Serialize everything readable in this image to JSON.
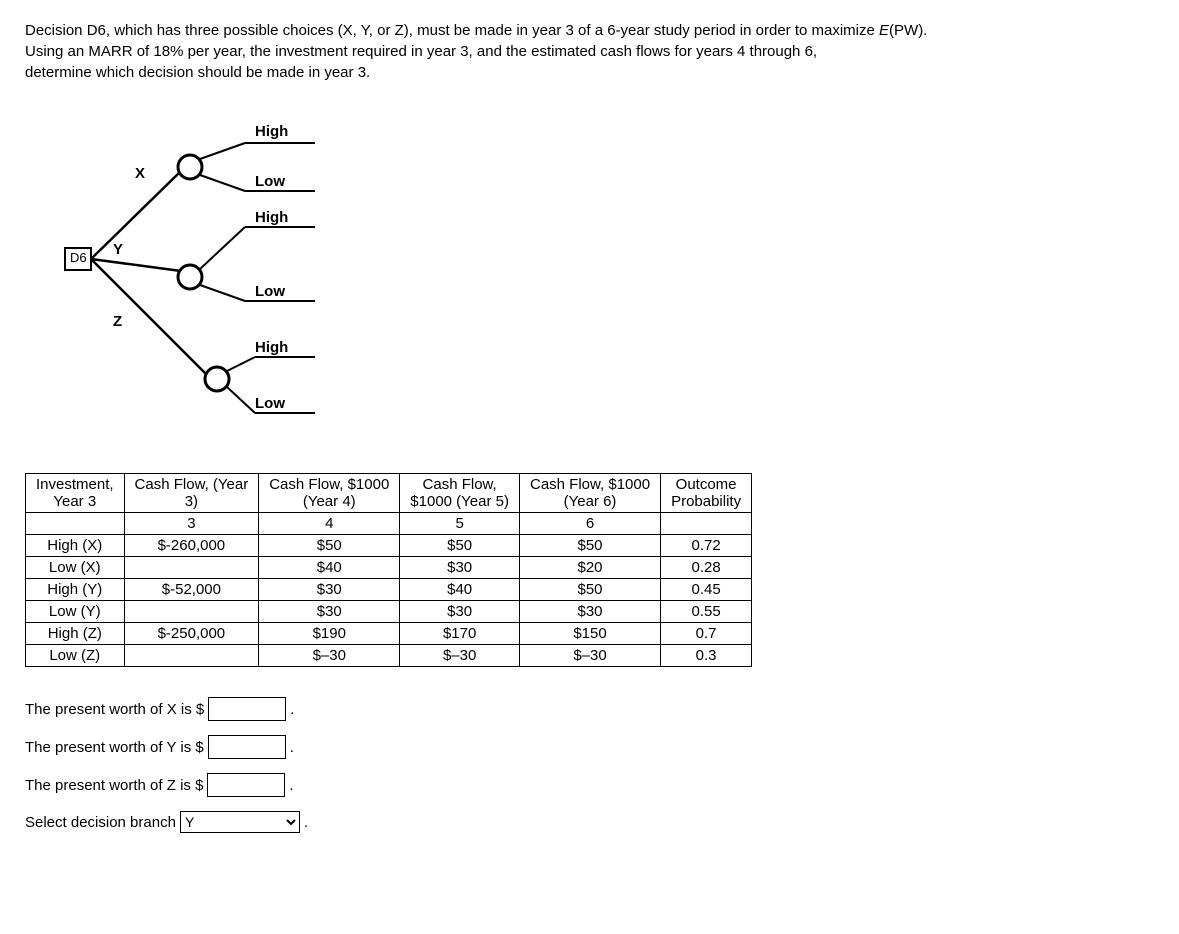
{
  "question": {
    "line1a": "Decision D6, which has three possible choices (X, Y, or Z), must be made in year 3 of a 6-year study period in order to maximize ",
    "line1b": "E",
    "line1c": "(PW).",
    "line2": "Using an MARR of 18% per year, the investment required in year 3, and the estimated cash flows for years 4 through 6,",
    "line3": "determine which decision should be made in year 3."
  },
  "diagram": {
    "d6": "D6",
    "x": "X",
    "y": "Y",
    "z": "Z",
    "high": "High",
    "low": "Low"
  },
  "table": {
    "h1a": "Investment,",
    "h1b": "Year 3",
    "h2a": "Cash Flow, (Year",
    "h2b": "3)",
    "h3a": "Cash Flow, $1000",
    "h3b": "(Year 4)",
    "h4a": "Cash Flow,",
    "h4b": "$1000 (Year 5)",
    "h5a": "Cash Flow, $1000",
    "h5b": "(Year 6)",
    "h6a": "Outcome",
    "h6b": "Probability",
    "sub2": "3",
    "sub3": "4",
    "sub4": "5",
    "sub5": "6",
    "r1c1": "High (X)",
    "r1c2": "$-260,000",
    "r1c3": "$50",
    "r1c4": "$50",
    "r1c5": "$50",
    "r1c6": "0.72",
    "r2c1": "Low (X)",
    "r2c2": "",
    "r2c3": "$40",
    "r2c4": "$30",
    "r2c5": "$20",
    "r2c6": "0.28",
    "r3c1": "High (Y)",
    "r3c2": "$-52,000",
    "r3c3": "$30",
    "r3c4": "$40",
    "r3c5": "$50",
    "r3c6": "0.45",
    "r4c1": "Low (Y)",
    "r4c2": "",
    "r4c3": "$30",
    "r4c4": "$30",
    "r4c5": "$30",
    "r4c6": "0.55",
    "r5c1": "High (Z)",
    "r5c2": "$-250,000",
    "r5c3": "$190",
    "r5c4": "$170",
    "r5c5": "$150",
    "r5c6": "0.7",
    "r6c1": "Low (Z)",
    "r6c2": "",
    "r6c3": "$–30",
    "r6c4": "$–30",
    "r6c5": "$–30",
    "r6c6": "0.3"
  },
  "answers": {
    "px_label": "The present worth of X is $",
    "py_label": "The present worth of Y is $",
    "pz_label": "The present worth of Z is $",
    "select_label": "Select decision branch",
    "select_value": "Y",
    "period": "."
  }
}
